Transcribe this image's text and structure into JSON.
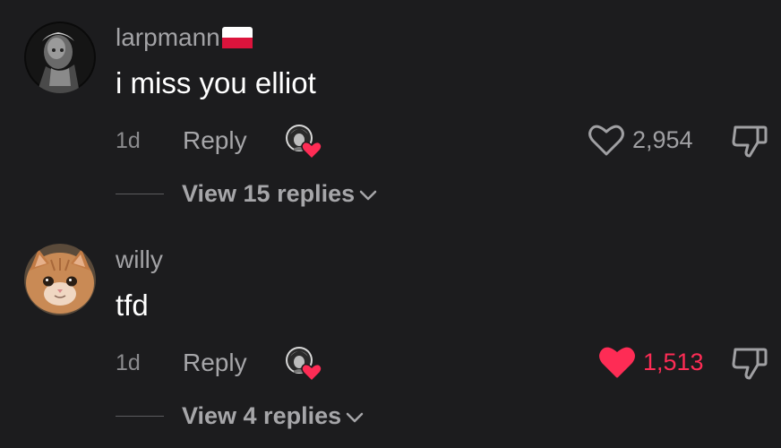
{
  "comments": [
    {
      "username": "larpmann",
      "flag": "poland-flag-icon",
      "avatar": "statue-avatar",
      "text": "i miss you elliot",
      "time": "1d",
      "reply_label": "Reply",
      "likes": "2,954",
      "liked": false,
      "view_replies": "View 15 replies"
    },
    {
      "username": "willy",
      "avatar": "cat-avatar",
      "text": "tfd",
      "time": "1d",
      "reply_label": "Reply",
      "likes": "1,513",
      "liked": true,
      "view_replies": "View 4 replies"
    }
  ],
  "colors": {
    "background": "#1c1c1e",
    "like_active": "#fe2c55",
    "secondary_text": "#a6a6a9",
    "primary_text": "#ffffff"
  }
}
